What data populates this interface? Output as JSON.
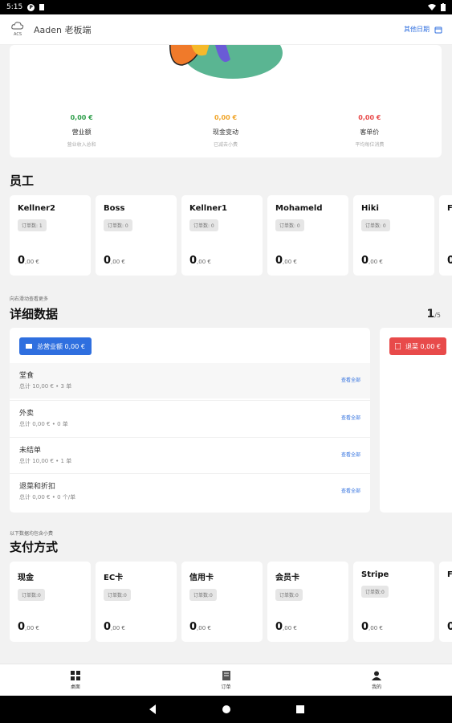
{
  "status_bar": {
    "time": "5:15",
    "icons": [
      "notification-p-icon",
      "sim-icon",
      "wifi-icon",
      "battery-icon"
    ]
  },
  "app_bar": {
    "logo_text": "ACS",
    "title": "Aaden 老板端",
    "date_button": "其他日期"
  },
  "summary": {
    "stats": [
      {
        "value": "0,00 €",
        "label": "营业额",
        "sub": "营业收入总和",
        "color": "#2e9e4a"
      },
      {
        "value": "0,00 €",
        "label": "现金变动",
        "sub": "已减去小费",
        "color": "#f0a52a"
      },
      {
        "value": "0,00 €",
        "label": "客单价",
        "sub": "平均每位消费",
        "color": "#e84a4a"
      }
    ]
  },
  "staff": {
    "title": "员工",
    "cards": [
      {
        "name": "Kellner2",
        "badge": "订单数: 1",
        "amount_int": "0",
        "amount_dec": ",00 €"
      },
      {
        "name": "Boss",
        "badge": "订单数: 0",
        "amount_int": "0",
        "amount_dec": ",00 €"
      },
      {
        "name": "Kellner1",
        "badge": "订单数: 0",
        "amount_int": "0",
        "amount_dec": ",00 €"
      },
      {
        "name": "Mohameld",
        "badge": "订单数: 0",
        "amount_int": "0",
        "amount_dec": ",00 €"
      },
      {
        "name": "Hiki",
        "badge": "订单数: 0",
        "amount_int": "0",
        "amount_dec": ",00 €"
      },
      {
        "name": "F",
        "badge": "",
        "amount_int": "0",
        "amount_dec": ""
      }
    ]
  },
  "details": {
    "hint": "向右滑动查看更多",
    "title": "详细数据",
    "page": {
      "current": "1",
      "total": "/5"
    },
    "total_button": "总营业额  0,00 €",
    "rows": [
      {
        "name": "堂食",
        "sub": "总计 10,00 € • 3 单",
        "link": "查看全部"
      },
      {
        "name": "外卖",
        "sub": "总计 0,00 € • 0 单",
        "link": "查看全部"
      },
      {
        "name": "未结单",
        "sub": "总计 10,00 € • 1 单",
        "link": "查看全部"
      },
      {
        "name": "退菜和折扣",
        "sub": "总计 0,00 € • 0 个/单",
        "link": "查看全部"
      }
    ],
    "second_button": "退菜  0,00 €"
  },
  "payment": {
    "hint": "以下数据均包含小费",
    "title": "支付方式",
    "cards": [
      {
        "name": "现金",
        "badge": "订单数:0",
        "amount_int": "0",
        "amount_dec": ",00 €"
      },
      {
        "name": "EC卡",
        "badge": "订单数:0",
        "amount_int": "0",
        "amount_dec": ",00 €"
      },
      {
        "name": "信用卡",
        "badge": "订单数:0",
        "amount_int": "0",
        "amount_dec": ",00 €"
      },
      {
        "name": "会员卡",
        "badge": "订单数:0",
        "amount_int": "0",
        "amount_dec": ",00 €"
      },
      {
        "name": "Stripe",
        "badge": "订单数:0",
        "amount_int": "0",
        "amount_dec": ",00 €"
      },
      {
        "name": "F",
        "badge": "",
        "amount_int": "0",
        "amount_dec": ""
      }
    ]
  },
  "bottom_nav": {
    "items": [
      {
        "label": "桌面",
        "icon": "grid-icon"
      },
      {
        "label": "订单",
        "icon": "receipt-icon"
      },
      {
        "label": "我的",
        "icon": "person-icon"
      }
    ]
  }
}
